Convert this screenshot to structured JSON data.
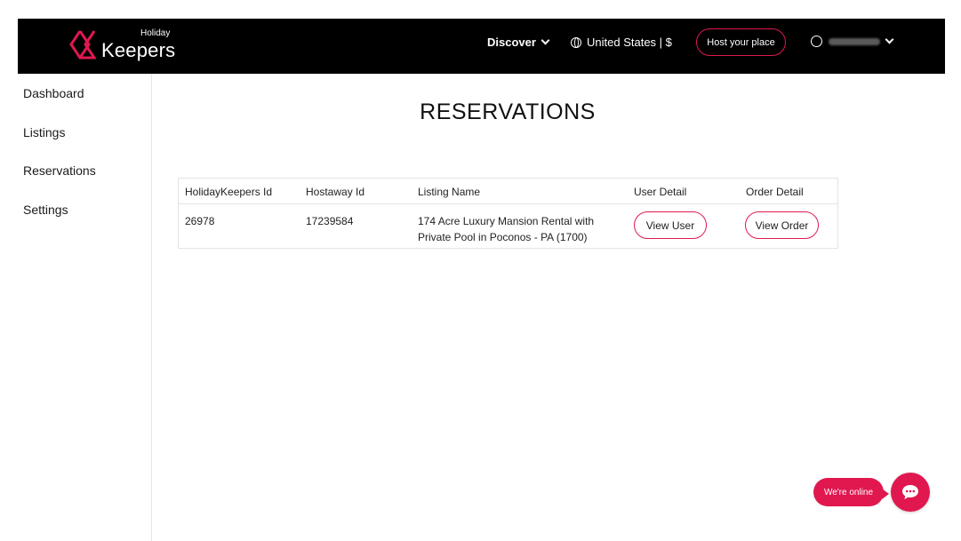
{
  "brand": {
    "small": "Holiday",
    "big": "Keepers",
    "accent": "#e0184f"
  },
  "nav": {
    "discover": "Discover",
    "region": "United States | $",
    "host_button": "Host your place",
    "user_icon": "user-circle-icon"
  },
  "sidebar": {
    "items": [
      {
        "label": "Dashboard"
      },
      {
        "label": "Listings"
      },
      {
        "label": "Reservations"
      },
      {
        "label": "Settings"
      }
    ]
  },
  "main": {
    "title": "RESERVATIONS",
    "table": {
      "headers": [
        "HolidayKeepers Id",
        "Hostaway Id",
        "Listing Name",
        "User Detail",
        "Order Detail"
      ],
      "rows": [
        {
          "holidaykeepers_id": "26978",
          "hostaway_id": "17239584",
          "listing_name_line1": "174 Acre Luxury Mansion Rental with",
          "listing_name_line2": "Private Pool in Poconos - PA (1700)",
          "user_button": "View User",
          "order_button": "View Order"
        }
      ]
    }
  },
  "chat": {
    "status": "We're online",
    "icon": "chat-bubble-icon"
  }
}
